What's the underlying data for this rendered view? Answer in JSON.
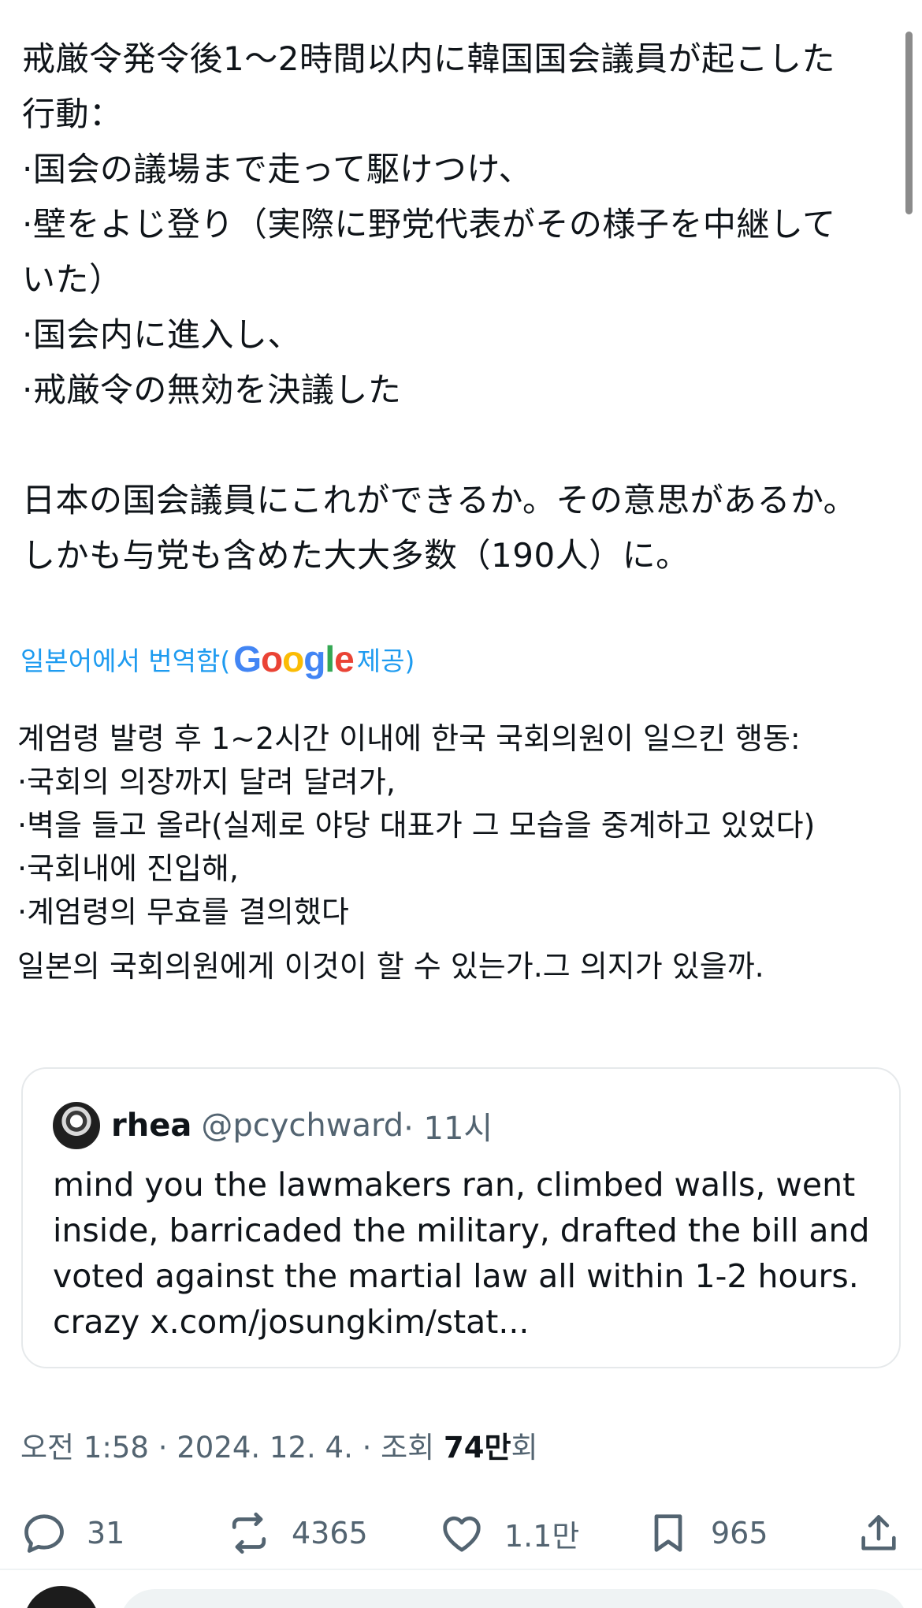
{
  "post": {
    "original_lines": [
      "戒厳令発令後1～2時間以内に韓国国会議員が起こした",
      "行動：",
      "·国会の議場まで走って駆けつけ、",
      "·壁をよじ登り（実際に野党代表がその様子を中継して",
      "いた）",
      "·国会内に進入し、",
      "·戒厳令の無効を決議した",
      "日本の国会議員にこれができるか。その意思があるか。",
      "しかも与党も含めた大大多数（190人）に。"
    ],
    "translate_label": "일본어에서 번역함(",
    "translate_provider_suffix": " 제공)",
    "google_letters": [
      "G",
      "o",
      "o",
      "g",
      "l",
      "e"
    ],
    "google_colors": [
      "#4285F4",
      "#EA4335",
      "#FBBC05",
      "#4285F4",
      "#34A853",
      "#EA4335"
    ],
    "translated_lines": [
      "계엄령 발령 후 1~2시간 이내에 한국 국회의원이 일으킨 행동:",
      "·국회의 의장까지 달려 달려가,",
      "·벽을 들고 올라(실제로 야당 대표가 그 모습을 중계하고 있었다)",
      "·국회내에 진입해,",
      "·계엄령의 무효를 결의했다",
      "일본의 국회의원에게 이것이 할 수 있는가.그 의지가 있을까."
    ]
  },
  "quote": {
    "name": "rhea",
    "handle": "@pcychward",
    "time": "· 11시",
    "text": "mind you the lawmakers ran, climbed walls, went inside, barricaded the military, drafted the bill and voted against the martial law all within 1-2 hours. crazy x.com/josungkim/stat..."
  },
  "meta": {
    "time": "오전 1:58",
    "sep1": " · ",
    "date": "2024. 12. 4.",
    "sep2": " · 조회 ",
    "views": "74만",
    "views_suffix": "회"
  },
  "actions": {
    "replies": "31",
    "reposts": "4365",
    "likes": "1.1만",
    "bookmarks": "965"
  },
  "colors": {
    "accent": "#1d9bf0",
    "text": "#0f1419",
    "muted": "#536471"
  }
}
